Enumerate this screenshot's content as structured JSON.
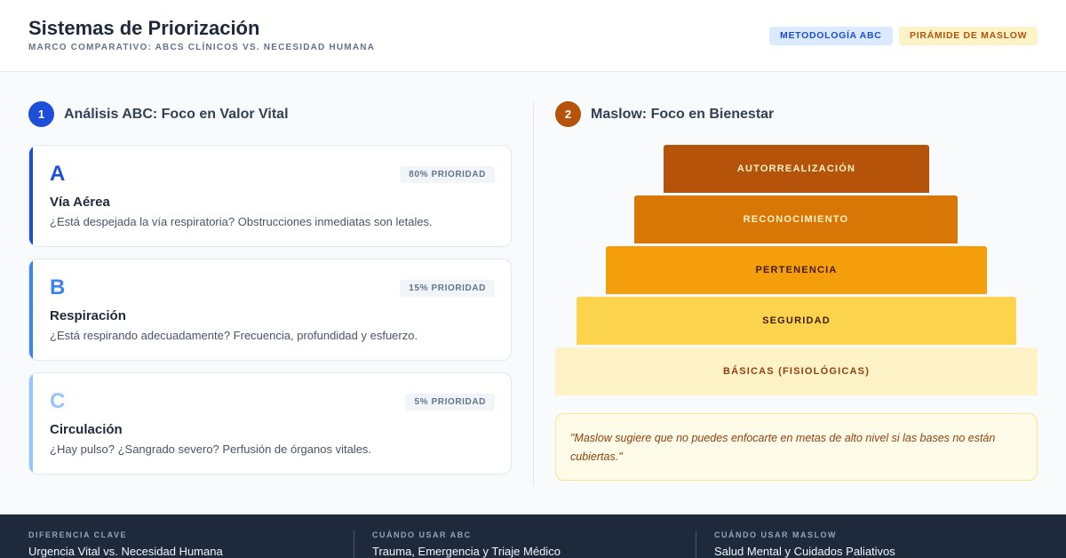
{
  "header": {
    "title": "Sistemas de Priorización",
    "subtitle": "MARCO COMPARATIVO: ABCS CLÍNICOS VS. NECESIDAD HUMANA",
    "tags": [
      {
        "label": "METODOLOGÍA ABC"
      },
      {
        "label": "PIRÁMIDE DE MASLOW"
      }
    ]
  },
  "abc": {
    "number": "1",
    "title": "Análisis ABC: Foco en Valor Vital",
    "cards": [
      {
        "letter": "A",
        "badge": "80% PRIORIDAD",
        "priority_percent": 80,
        "title": "Vía Aérea",
        "description": "¿Está despejada la vía respiratoria? Obstrucciones inmediatas son letales.",
        "color": "#1d4ed8"
      },
      {
        "letter": "B",
        "badge": "15% PRIORIDAD",
        "priority_percent": 15,
        "title": "Respiración",
        "description": "¿Está respirando adecuadamente? Frecuencia, profundidad y esfuerzo.",
        "color": "#3b82f6"
      },
      {
        "letter": "C",
        "badge": "5% PRIORIDAD",
        "priority_percent": 5,
        "title": "Circulación",
        "description": "¿Hay pulso? ¿Sangrado severo? Perfusión de órganos vitales.",
        "color": "#93c5fd"
      }
    ]
  },
  "maslow": {
    "number": "2",
    "title": "Maslow: Foco en Bienestar",
    "levels": [
      {
        "label": "AUTORREALIZACIÓN",
        "bg": "#b45309",
        "fg": "#fef3c7"
      },
      {
        "label": "RECONOCIMIENTO",
        "bg": "#d97706",
        "fg": "#fef3c7"
      },
      {
        "label": "PERTENENCIA",
        "bg": "#f59e0b",
        "fg": "#451a03"
      },
      {
        "label": "SEGURIDAD",
        "bg": "#fcd34d",
        "fg": "#451a03"
      },
      {
        "label": "BÁSICAS (FISIOLÓGICAS)",
        "bg": "#fef3c7",
        "fg": "#92400e"
      }
    ],
    "quote": "\"Maslow sugiere que no puedes enfocarte en metas de alto nivel si las bases no están cubiertas.\""
  },
  "footer": [
    {
      "label": "DIFERENCIA CLAVE",
      "value": "Urgencia Vital vs. Necesidad Humana"
    },
    {
      "label": "CUÁNDO USAR ABC",
      "value": "Trauma, Emergencia y Triaje Médico"
    },
    {
      "label": "CUÁNDO USAR MASLOW",
      "value": "Salud Mental y Cuidados Paliativos"
    }
  ],
  "colors": {
    "abc_accent": "#1d4ed8",
    "maslow_accent": "#b45309",
    "footer_bg": "#1e293b"
  }
}
